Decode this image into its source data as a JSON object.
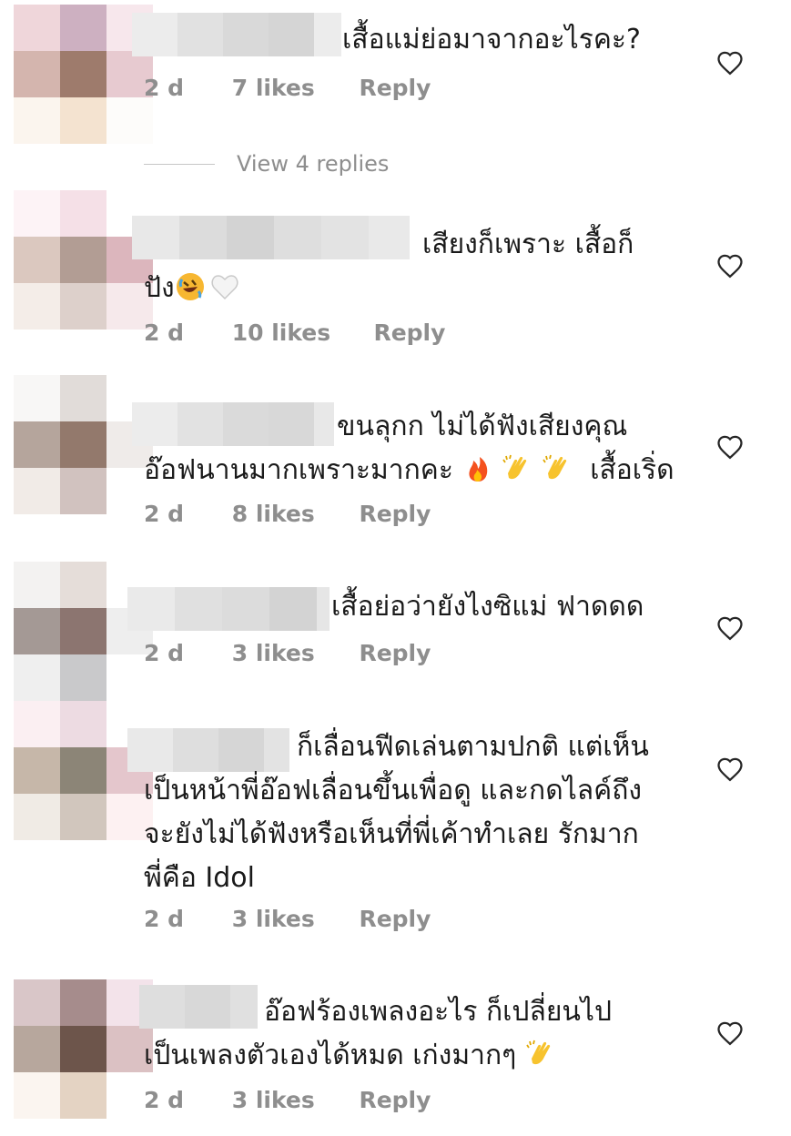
{
  "comments": [
    {
      "text_lines": [
        "เสื้อแม่ย่อมาจากอะไรคะ?"
      ],
      "age": "2 d",
      "likes": "7 likes",
      "reply": "Reply",
      "view_replies": "View 4 replies"
    },
    {
      "text_lines": [
        "เสียงก็เพราะ เสื้อก็",
        "ปัง"
      ],
      "emojis": [
        "rolling-laughing-emoji",
        "white-heart-emoji"
      ],
      "age": "2 d",
      "likes": "10 likes",
      "reply": "Reply"
    },
    {
      "text_lines": [
        "ขนลุกก ไม่ได้ฟังเสียงคุณ",
        "อ๊อฟนานมากเพราะมากคะ",
        "เสื้อเริ่ด"
      ],
      "emojis": [
        "fire-emoji",
        "clapping-hands-emoji",
        "clapping-hands-emoji"
      ],
      "age": "2 d",
      "likes": "8 likes",
      "reply": "Reply"
    },
    {
      "text_lines": [
        "เสื้อย่อว่ายังไงซิแม่ ฟาดดด"
      ],
      "age": "2 d",
      "likes": "3 likes",
      "reply": "Reply"
    },
    {
      "text_lines": [
        "ก็เลื่อนฟีดเล่นตามปกติ แต่เห็น",
        "เป็นหน้าพี่อ๊อฟเลื่อนขึ้นเพื่อดู และกดไลค์ถึง",
        "จะยังไม่ได้ฟังหรือเห็นที่พี่เค้าทำเลย รักมาก",
        "พี่คือ Idol"
      ],
      "age": "2 d",
      "likes": "3 likes",
      "reply": "Reply"
    },
    {
      "text_lines": [
        "อ๊อฟร้องเพลงอะไร ก็เปลี่ยนไป",
        "เป็นเพลงตัวเองได้หมด เก่งมากๆ"
      ],
      "emojis": [
        "clapping-hands-emoji"
      ],
      "age": "2 d",
      "likes": "3 likes",
      "reply": "Reply"
    }
  ],
  "icons": {
    "like": "heart-outline-icon"
  },
  "colors": {
    "meta_text": "#8e8e8e",
    "body_text": "#1a1a1a"
  }
}
